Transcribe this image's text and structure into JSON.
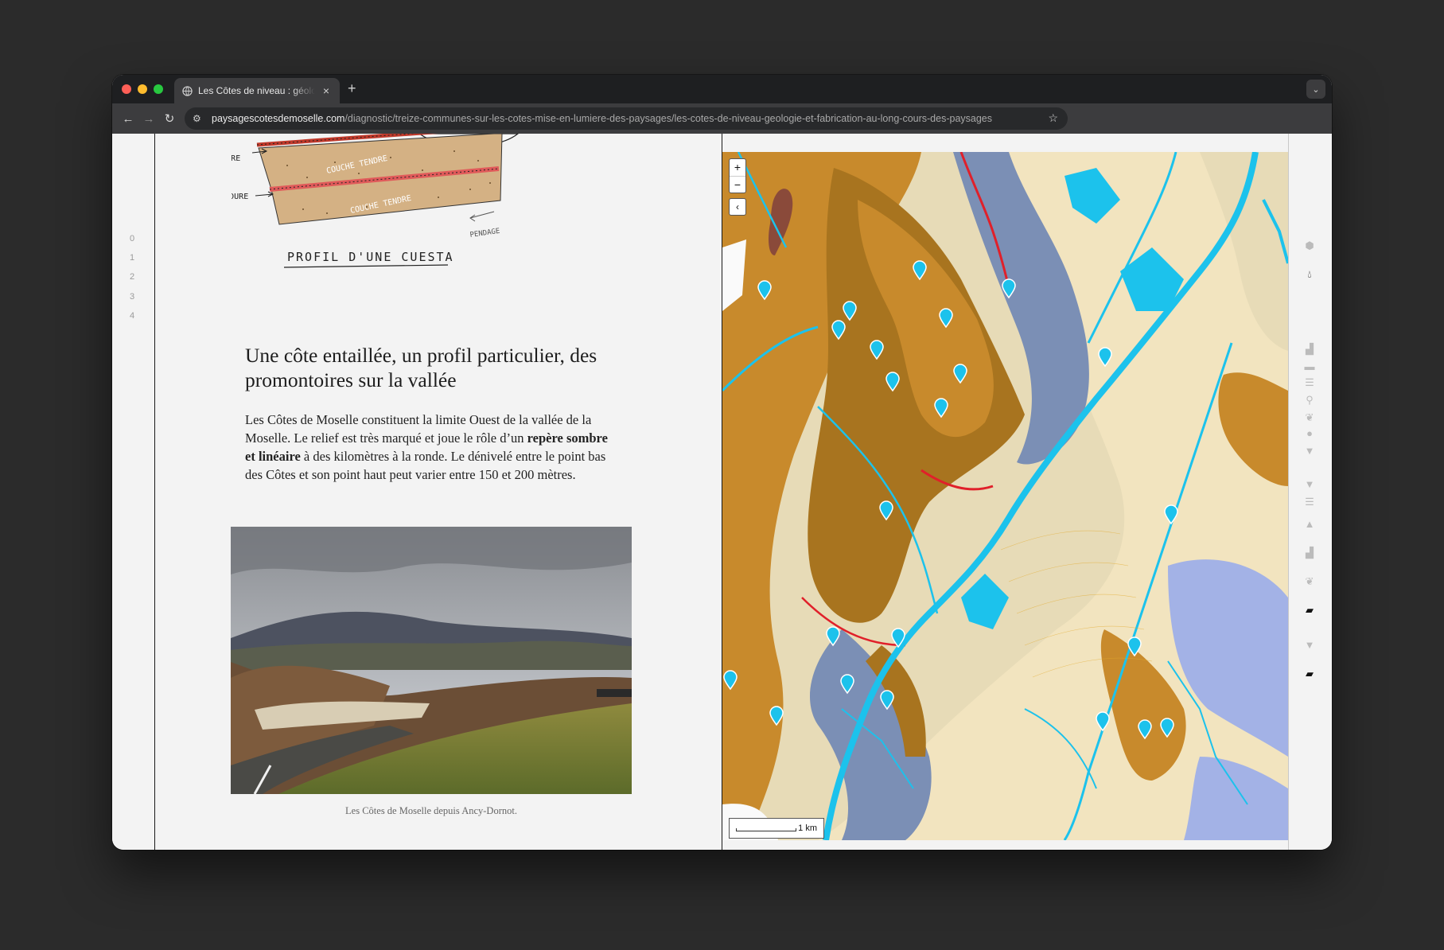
{
  "browser": {
    "tab_title": "Les Côtes de niveau : géologie et fabrication au long cours des paysages",
    "tab_close": "×",
    "new_tab": "+",
    "tab_menu": "⌄",
    "url_host": "paysagescotesdemoselle.com",
    "url_path": "/diagnostic/treize-communes-sur-les-cotes-mise-en-lumiere-des-paysages/les-cotes-de-niveau-geologie-et-fabrication-au-long-cours-des-paysages",
    "back": "←",
    "forward": "→",
    "reload": "↻",
    "site_info": "⚙",
    "bookmark": "☆"
  },
  "section_index": [
    "0",
    "1",
    "2",
    "3",
    "4"
  ],
  "sketch": {
    "label_hard_1": "COUCHE DURE",
    "label_hard_2": "COUCHE DURE",
    "label_soft_1": "COUCHE TENDRE",
    "label_soft_2": "COUCHE TENDRE",
    "label_dip": "PENDAGE",
    "title": "PROFIL D'UNE CUESTA"
  },
  "article": {
    "title": "Une côte entaillée, un profil particulier, des promontoires sur la vallée",
    "body_before": "Les Côtes de Moselle constituent la limite Ouest de la vallée de la Moselle. Le relief est très marqué et joue le rôle d’un ",
    "body_bold": "repère sombre et linéaire",
    "body_after": " à des kilomètres à la ronde. Le dénivelé entre le point bas des Côtes et son point haut peut varier entre 150 et 200 mètres.",
    "caption": "Les Côtes de Moselle depuis Ancy-Dornot."
  },
  "map": {
    "zoom_in": "+",
    "zoom_out": "−",
    "collapse": "‹",
    "scale_label": "1 km",
    "colors": {
      "alluvium": "#f2e4bf",
      "marl": "#e7dbb7",
      "limestone": "#c88a2c",
      "limestone_dark": "#a8741f",
      "clay_blue": "#7b8fb5",
      "clay_light": "#a3b2e6",
      "river": "#1cc2ec",
      "fault": "#e0202a",
      "brown": "#8a4a3a"
    }
  },
  "legend_icons": [
    "hexagon-icon",
    "drop-icon",
    "building-icon",
    "vehicle-icon",
    "road-icon",
    "pin-icon",
    "leaf-icon",
    "tree-icon",
    "shield-icon",
    "shield-icon",
    "road-icon",
    "mountain-icon",
    "building-icon",
    "leaf-icon",
    "parallelogram-icon",
    "shield-icon",
    "parallelogram-icon"
  ]
}
